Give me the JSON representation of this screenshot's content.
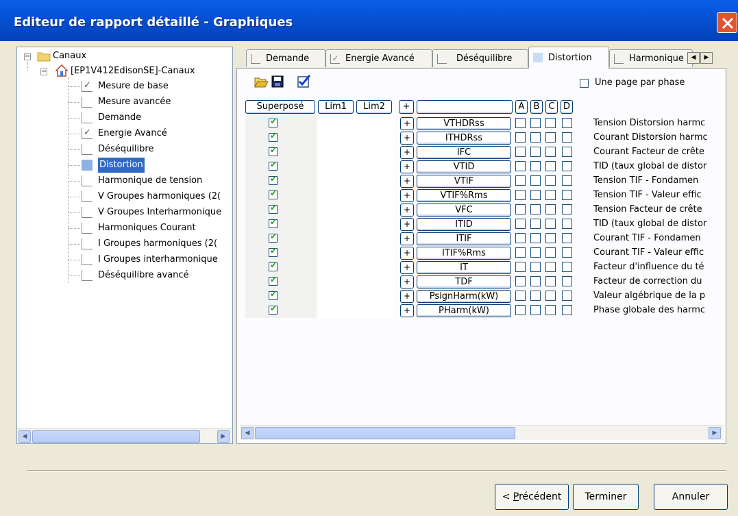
{
  "window": {
    "title": "Editeur de rapport détaillé - Graphiques",
    "close_label": "×"
  },
  "tree": {
    "root_label": "Canaux",
    "device_label": "[EP1V412EdisonSE]-Canaux",
    "items": [
      {
        "label": "Mesure de base",
        "checked": true,
        "selected": false
      },
      {
        "label": "Mesure avancée",
        "checked": false,
        "selected": false
      },
      {
        "label": "Demande",
        "checked": false,
        "selected": false
      },
      {
        "label": "Energie Avancé",
        "checked": true,
        "selected": false
      },
      {
        "label": "Déséquilibre",
        "checked": false,
        "selected": false
      },
      {
        "label": "Distortion",
        "checked": false,
        "selected": true
      },
      {
        "label": "Harmonique de tension",
        "checked": false,
        "selected": false
      },
      {
        "label": "V Groupes harmoniques (2(",
        "checked": false,
        "selected": false
      },
      {
        "label": "V Groupes Interharmonique",
        "checked": false,
        "selected": false
      },
      {
        "label": "Harmoniques Courant",
        "checked": false,
        "selected": false
      },
      {
        "label": "I Groupes harmoniques (2(",
        "checked": false,
        "selected": false
      },
      {
        "label": "I Groupes interharmonique",
        "checked": false,
        "selected": false
      },
      {
        "label": "Déséquilibre avancé",
        "checked": false,
        "selected": false
      }
    ]
  },
  "tabs": [
    {
      "label": "Demande",
      "checked": false
    },
    {
      "label": "Energie Avancé",
      "checked": true
    },
    {
      "label": "Déséquilibre",
      "checked": false
    },
    {
      "label": "Distortion",
      "checked": false,
      "active": true
    },
    {
      "label": "Harmonique",
      "checked": false
    }
  ],
  "toolbar": {
    "icons": [
      "open-folder-icon",
      "save-disk-icon",
      "check-all-icon"
    ],
    "one_page_label": "Une page par phase"
  },
  "grid": {
    "headers": {
      "superpose": "Superposé",
      "lim1": "Lim1",
      "lim2": "Lim2",
      "plus": "+",
      "name": "",
      "a": "A",
      "b": "B",
      "c": "C",
      "d": "D"
    },
    "plus_label": "+",
    "rows": [
      {
        "name": "VTHDRss",
        "desc": "Tension Distorsion harmc"
      },
      {
        "name": "ITHDRss",
        "desc": "Courant Distorsion harmc"
      },
      {
        "name": "IFC",
        "desc": "Courant Facteur de crête"
      },
      {
        "name": "VTID",
        "desc": "TID (taux global de distor"
      },
      {
        "name": "VTIF",
        "desc": "Tension TIF - Fondamen"
      },
      {
        "name": "VTIF%Rms",
        "desc": "Tension TIF - Valeur effic"
      },
      {
        "name": "VFC",
        "desc": "Tension Facteur de crête"
      },
      {
        "name": "ITID",
        "desc": "TID (taux global de distor"
      },
      {
        "name": "ITIF",
        "desc": "Courant TIF - Fondamen"
      },
      {
        "name": "ITIF%Rms",
        "desc": "Courant TIF - Valeur effic"
      },
      {
        "name": "IT",
        "desc": "Facteur d'influence du té"
      },
      {
        "name": "TDF",
        "desc": "Facteur de correction du"
      },
      {
        "name": "PsignHarm(kW)",
        "desc": "Valeur algébrique de la p"
      },
      {
        "name": "PHarm(kW)",
        "desc": "Phase globale des harmc"
      }
    ]
  },
  "buttons": {
    "previous_prefix": "< ",
    "previous_underline": "P",
    "previous_rest": "récédent",
    "finish": "Terminer",
    "cancel": "Annuler"
  },
  "colors": {
    "titlebar": "#0552d6",
    "selection": "#316ac5",
    "check_green": "#21a121"
  }
}
